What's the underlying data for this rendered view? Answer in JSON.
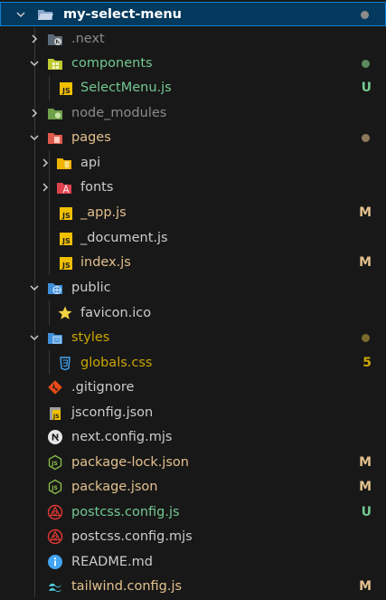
{
  "colors": {
    "default_text": "#cccccc",
    "dim_text": "#8b8b8b",
    "added": "#73c991",
    "modified": "#e2c08d",
    "problem": "#cca700"
  },
  "tree": {
    "root": {
      "label": "my-select-menu"
    },
    "items": [
      {
        "label": ".next",
        "icon": "next-folder-icon"
      },
      {
        "label": "components",
        "icon": "components-folder-icon"
      },
      {
        "label": "SelectMenu.js",
        "icon": "js-file-icon",
        "badge": "U"
      },
      {
        "label": "node_modules",
        "icon": "node-folder-icon"
      },
      {
        "label": "pages",
        "icon": "pages-folder-icon"
      },
      {
        "label": "api",
        "icon": "api-folder-icon"
      },
      {
        "label": "fonts",
        "icon": "fonts-folder-icon"
      },
      {
        "label": "_app.js",
        "icon": "js-file-icon",
        "badge": "M"
      },
      {
        "label": "_document.js",
        "icon": "js-file-icon"
      },
      {
        "label": "index.js",
        "icon": "js-file-icon",
        "badge": "M"
      },
      {
        "label": "public",
        "icon": "public-folder-icon"
      },
      {
        "label": "favicon.ico",
        "icon": "star-icon"
      },
      {
        "label": "styles",
        "icon": "styles-folder-icon"
      },
      {
        "label": "globals.css",
        "icon": "css-file-icon",
        "badge": "5"
      },
      {
        "label": ".gitignore",
        "icon": "git-icon"
      },
      {
        "label": "jsconfig.json",
        "icon": "json-file-icon"
      },
      {
        "label": "next.config.mjs",
        "icon": "nextjs-icon"
      },
      {
        "label": "package-lock.json",
        "icon": "node-file-icon",
        "badge": "M"
      },
      {
        "label": "package.json",
        "icon": "node-file-icon",
        "badge": "M"
      },
      {
        "label": "postcss.config.js",
        "icon": "postcss-icon",
        "badge": "U"
      },
      {
        "label": "postcss.config.mjs",
        "icon": "postcss-icon"
      },
      {
        "label": "README.md",
        "icon": "info-icon"
      },
      {
        "label": "tailwind.config.js",
        "icon": "tailwind-icon",
        "badge": "M"
      }
    ]
  }
}
